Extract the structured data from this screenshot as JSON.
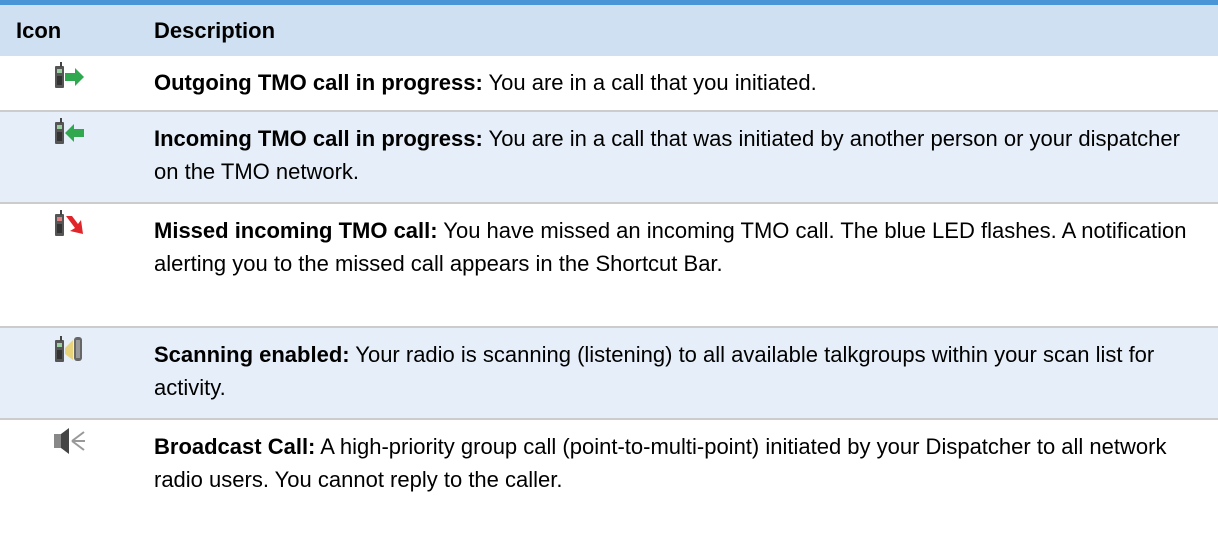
{
  "header": {
    "icon_col": "Icon",
    "desc_col": "Description"
  },
  "rows": [
    {
      "icon": "outgoing-call-icon",
      "title": "Outgoing TMO call in progress:",
      "text": " You are in a call that you initiated."
    },
    {
      "icon": "incoming-call-icon",
      "title": "Incoming TMO call in progress:",
      "text": " You are in a call that was initiated by another person or your dispatcher on the TMO network."
    },
    {
      "icon": "missed-call-icon",
      "title": "Missed incoming TMO call:",
      "text": " You have missed an incoming TMO call. The blue LED flashes. A notification alerting you to the missed call appears in the Shortcut Bar."
    },
    {
      "icon": "scanning-icon",
      "title": "Scanning enabled:",
      "text": " Your radio is scanning (listening) to all available talkgroups within your scan list for activity."
    },
    {
      "icon": "broadcast-call-icon",
      "title": "Broadcast Call:",
      "text": " A high-priority group call (point-to-multi-point) initiated by your Dispatcher to all network radio users. You cannot reply to the caller."
    }
  ],
  "colors": {
    "header_bg": "#cfe0f2",
    "alt_row_bg": "#e6eff9",
    "top_rule": "#4a95d6"
  }
}
